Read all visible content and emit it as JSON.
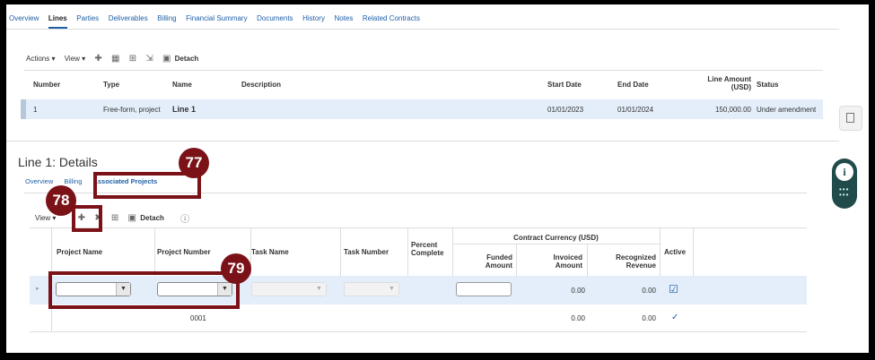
{
  "tabs": [
    "Overview",
    "Lines",
    "Parties",
    "Deliverables",
    "Billing",
    "Financial Summary",
    "Documents",
    "History",
    "Notes",
    "Related Contracts"
  ],
  "toolbar": {
    "actions": "Actions ▾",
    "view": "View ▾",
    "detach": "Detach"
  },
  "lines_table": {
    "headers": {
      "number": "Number",
      "type": "Type",
      "name": "Name",
      "description": "Description",
      "start_date": "Start Date",
      "end_date": "End Date",
      "line_amount": "Line Amount (USD)",
      "status": "Status"
    },
    "row": {
      "number": "1",
      "type": "Free-form, project",
      "name": "Line 1",
      "description": "",
      "start_date": "01/01/2023",
      "end_date": "01/01/2024",
      "line_amount": "150,000.00",
      "status": "Under amendment"
    }
  },
  "details": {
    "title": "Line 1: Details",
    "subtabs": [
      "Overview",
      "Billing",
      "Associated Projects"
    ],
    "toolbar": {
      "view": "View ▾",
      "detach": "Detach"
    },
    "headers": {
      "project_name": "Project Name",
      "project_number": "Project Number",
      "task_name": "Task Name",
      "task_number": "Task Number",
      "percent_complete": "Percent Complete",
      "currency_group": "Contract Currency (USD)",
      "funded_amount": "Funded Amount",
      "invoiced_amount": "Invoiced Amount",
      "recognized_revenue": "Recognized Revenue",
      "active": "Active"
    },
    "rows": [
      {
        "project_number": "",
        "invoiced": "0.00",
        "revenue": "0.00"
      },
      {
        "project_number": "0001",
        "invoiced": "0.00",
        "revenue": "0.00"
      }
    ]
  },
  "callouts": [
    "77",
    "78",
    "79"
  ]
}
